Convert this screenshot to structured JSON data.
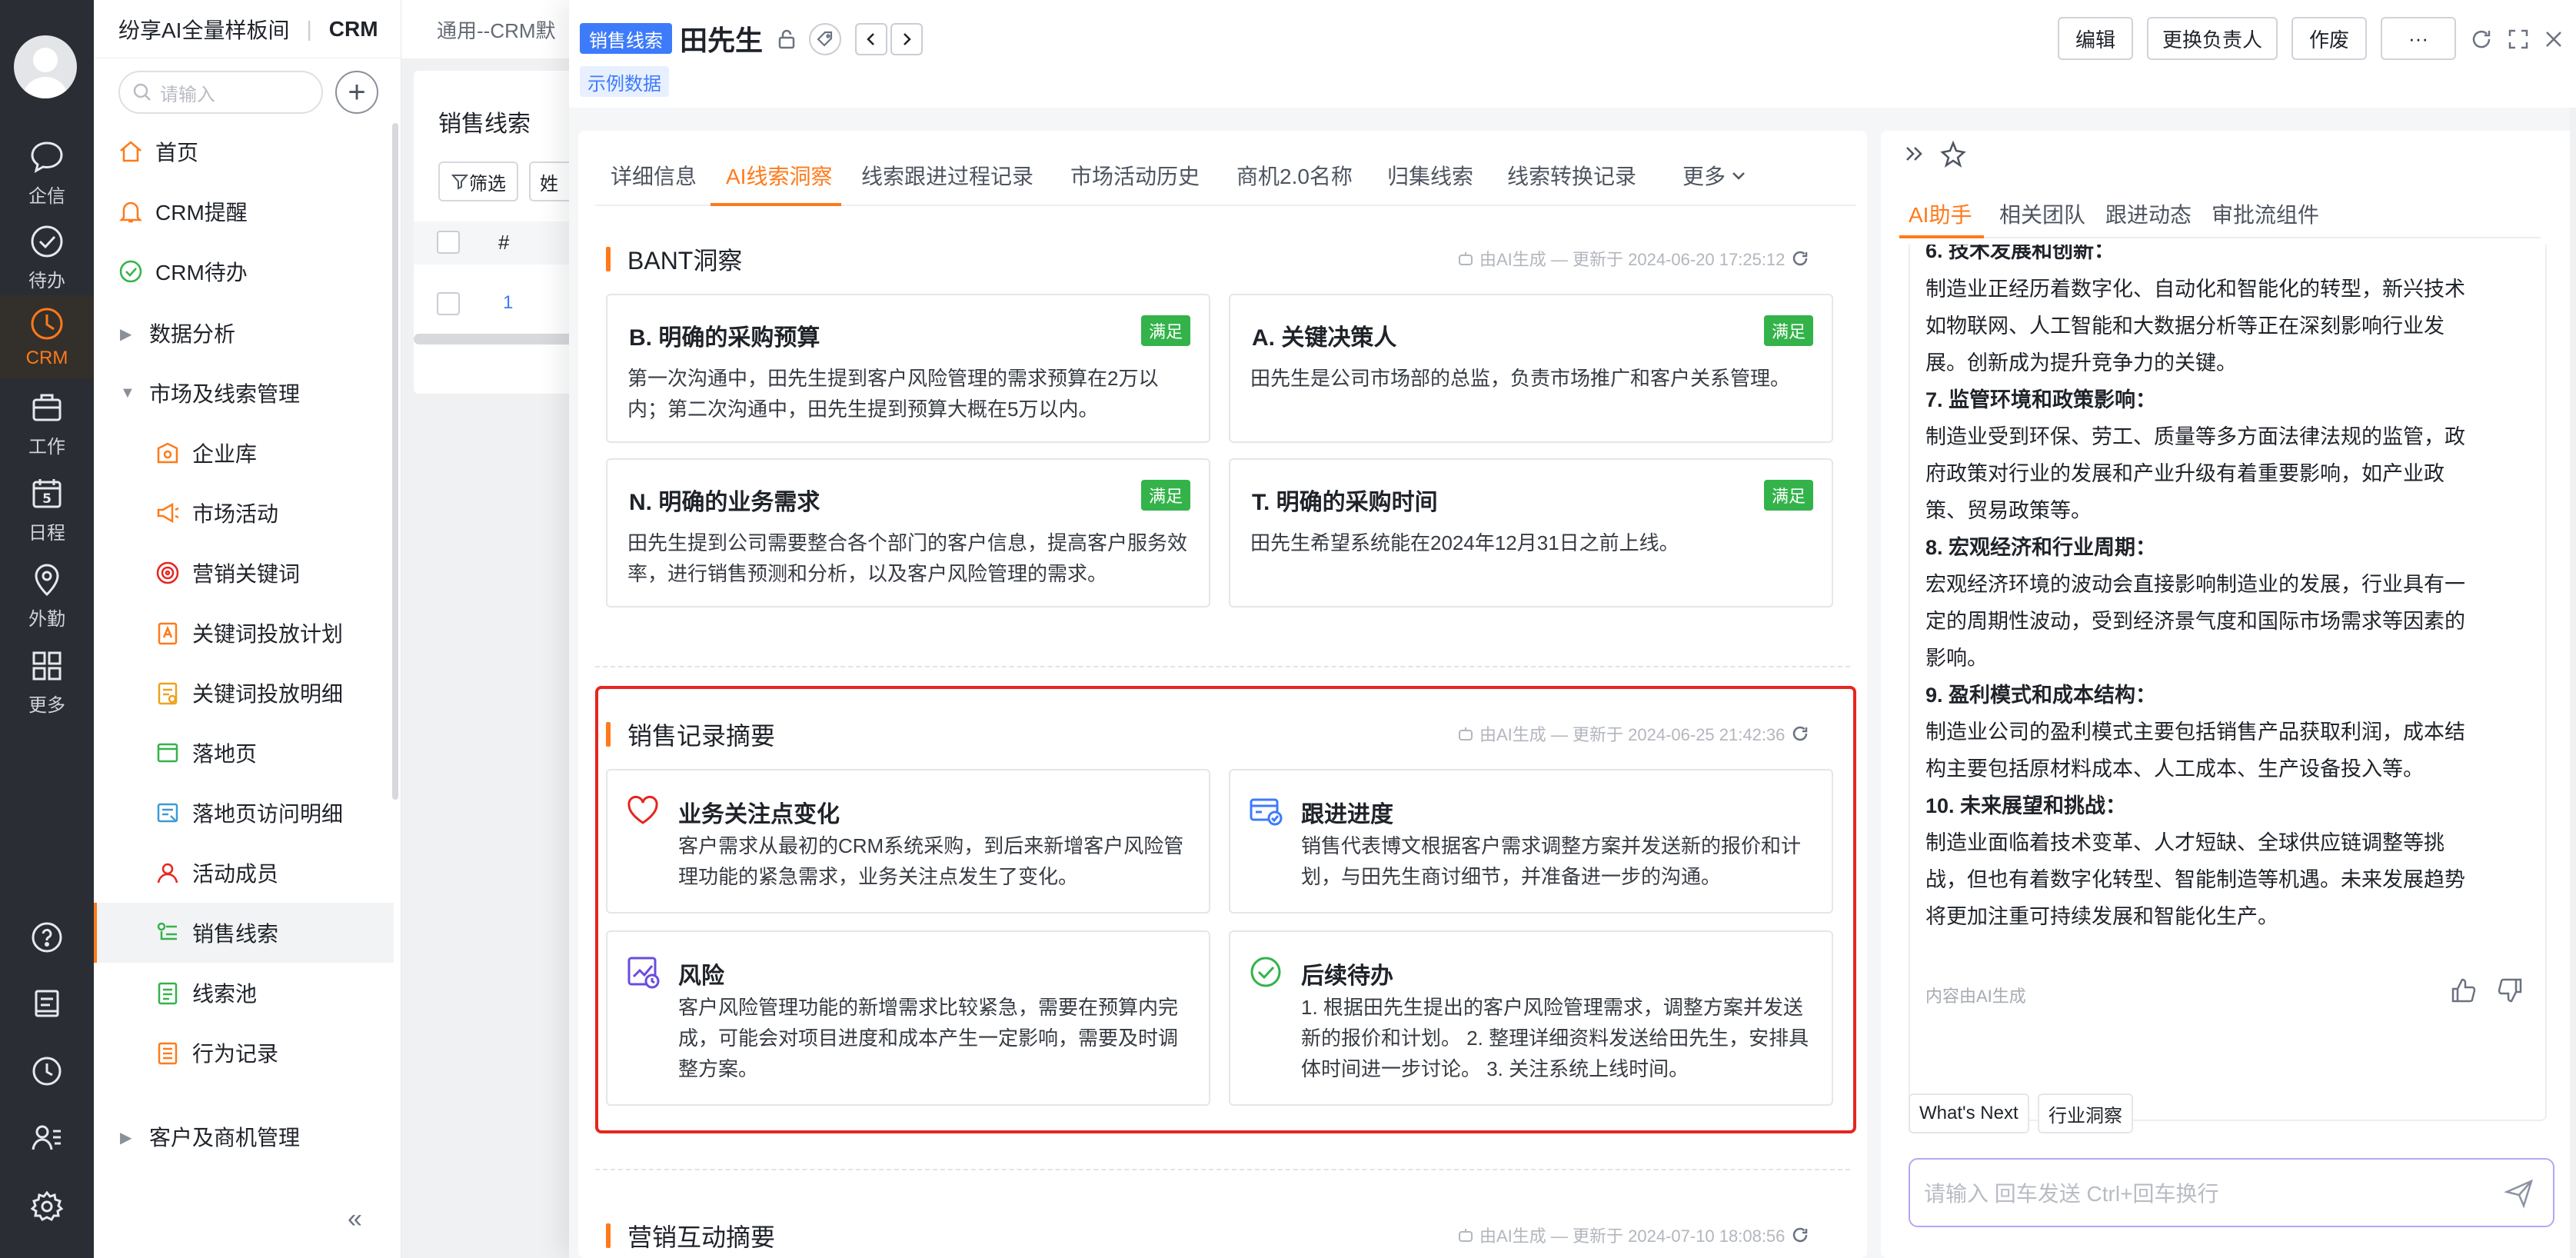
{
  "rail": {
    "items": [
      {
        "label": "企信",
        "icon": "chat-bubble-icon"
      },
      {
        "label": "待办",
        "icon": "check-circle-icon"
      },
      {
        "label": "CRM",
        "icon": "clock-icon"
      },
      {
        "label": "工作",
        "icon": "briefcase-icon"
      },
      {
        "label": "日程",
        "icon": "calendar-icon",
        "day": "5"
      },
      {
        "label": "外勤",
        "icon": "location-pin-icon"
      },
      {
        "label": "更多",
        "icon": "grid-icon"
      }
    ],
    "active_color": "#ff7a1a"
  },
  "nav": {
    "workspace": "纷享AI全量样板间",
    "app": "CRM",
    "search_placeholder": "请输入",
    "add": "+",
    "items": [
      {
        "label": "首页"
      },
      {
        "label": "CRM提醒"
      },
      {
        "label": "CRM待办"
      },
      {
        "label": "数据分析"
      },
      {
        "label": "市场及线索管理"
      },
      {
        "label": "企业库"
      },
      {
        "label": "市场活动"
      },
      {
        "label": "营销关键词"
      },
      {
        "label": "关键词投放计划"
      },
      {
        "label": "关键词投放明细"
      },
      {
        "label": "落地页"
      },
      {
        "label": "落地页访问明细"
      },
      {
        "label": "活动成员"
      },
      {
        "label": "销售线索"
      },
      {
        "label": "线索池"
      },
      {
        "label": "行为记录"
      },
      {
        "label": "客户及商机管理"
      }
    ],
    "collapse": "«"
  },
  "bg_page": {
    "tab": "通用--CRM默",
    "title": "销售线索",
    "filter": "筛选",
    "filter2": "姓",
    "col_index": "#",
    "row_index": "1"
  },
  "drawer": {
    "tag": "销售线索",
    "name": "田先生",
    "sample_tag": "示例数据",
    "buttons": {
      "edit": "编辑",
      "change_owner": "更换负责人",
      "void": "作废",
      "more": "···"
    },
    "tabs": [
      "详细信息",
      "AI线索洞察",
      "线索跟进过程记录",
      "市场活动历史",
      "商机2.0名称",
      "归集线索",
      "线索转换记录",
      "更多"
    ],
    "bant": {
      "title": "BANT洞察",
      "meta": "由AI生成 — 更新于 2024-06-20 17:25:12",
      "cards": [
        {
          "title": "B. 明确的采购预算",
          "badge": "满足",
          "desc": "第一次沟通中，田先生提到客户风险管理的需求预算在2万以内；第二次沟通中，田先生提到预算大概在5万以内。"
        },
        {
          "title": "A. 关键决策人",
          "badge": "满足",
          "desc": "田先生是公司市场部的总监，负责市场推广和客户关系管理。"
        },
        {
          "title": "N. 明确的业务需求",
          "badge": "满足",
          "desc": "田先生提到公司需要整合各个部门的客户信息，提高客户服务效率，进行销售预测和分析，以及客户风险管理的需求。"
        },
        {
          "title": "T. 明确的采购时间",
          "badge": "满足",
          "desc": "田先生希望系统能在2024年12月31日之前上线。"
        }
      ]
    },
    "summary": {
      "title": "销售记录摘要",
      "meta": "由AI生成 — 更新于 2024-06-25 21:42:36",
      "cards": [
        {
          "title": "业务关注点变化",
          "icon": "heart-icon",
          "desc": "客户需求从最初的CRM系统采购，到后来新增客户风险管理功能的紧急需求，业务关注点发生了变化。"
        },
        {
          "title": "跟进进度",
          "icon": "progress-card-icon",
          "desc": "销售代表博文根据客户需求调整方案并发送新的报价和计划，与田先生商讨细节，并准备进一步的沟通。"
        },
        {
          "title": "风险",
          "icon": "risk-chart-icon",
          "desc": "客户风险管理功能的新增需求比较紧急，需要在预算内完成，可能会对项目进度和成本产生一定影响，需要及时调整方案。"
        },
        {
          "title": "后续待办",
          "icon": "check-circle-icon",
          "desc": "1. 根据田先生提出的客户风险管理需求，调整方案并发送新的报价和计划。 2. 整理详细资料发送给田先生，安排具体时间进一步讨论。 3. 关注系统上线时间。"
        }
      ],
      "highlight_color": "#e5261f"
    },
    "marketing": {
      "title": "营销互动摘要",
      "meta": "由AI生成 — 更新于 2024-07-10 18:08:56"
    }
  },
  "ai_panel": {
    "tabs": [
      "AI助手",
      "相关团队",
      "跟进动态",
      "审批流组件"
    ],
    "lines": [
      {
        "text": "6. 技术发展和创新：",
        "bold": true
      },
      {
        "text": "制造业正经历着数字化、自动化和智能化的转型，新兴技术",
        "bold": false
      },
      {
        "text": "如物联网、人工智能和大数据分析等正在深刻影响行业发",
        "bold": false
      },
      {
        "text": "展。创新成为提升竞争力的关键。",
        "bold": false
      },
      {
        "text": "7. 监管环境和政策影响：",
        "bold": true
      },
      {
        "text": "制造业受到环保、劳工、质量等多方面法律法规的监管，政",
        "bold": false
      },
      {
        "text": "府政策对行业的发展和产业升级有着重要影响，如产业政",
        "bold": false
      },
      {
        "text": "策、贸易政策等。",
        "bold": false
      },
      {
        "text": "8. 宏观经济和行业周期：",
        "bold": true
      },
      {
        "text": "宏观经济环境的波动会直接影响制造业的发展，行业具有一",
        "bold": false
      },
      {
        "text": "定的周期性波动，受到经济景气度和国际市场需求等因素的",
        "bold": false
      },
      {
        "text": "影响。",
        "bold": false
      },
      {
        "text": "9. 盈利模式和成本结构：",
        "bold": true
      },
      {
        "text": "制造业公司的盈利模式主要包括销售产品获取利润，成本结",
        "bold": false
      },
      {
        "text": "构主要包括原材料成本、人工成本、生产设备投入等。",
        "bold": false
      },
      {
        "text": "10. 未来展望和挑战：",
        "bold": true
      },
      {
        "text": "制造业面临着技术变革、人才短缺、全球供应链调整等挑",
        "bold": false
      },
      {
        "text": "战，但也有着数字化转型、智能制造等机遇。未来发展趋势",
        "bold": false
      },
      {
        "text": "将更加注重可持续发展和智能化生产。",
        "bold": false
      }
    ],
    "footer": "内容由AI生成",
    "chips": [
      "What's Next",
      "行业洞察"
    ],
    "input_placeholder": "请输入 回车发送 Ctrl+回车换行",
    "accent": "#ff7a1a",
    "input_border": "#b9a4f5"
  }
}
